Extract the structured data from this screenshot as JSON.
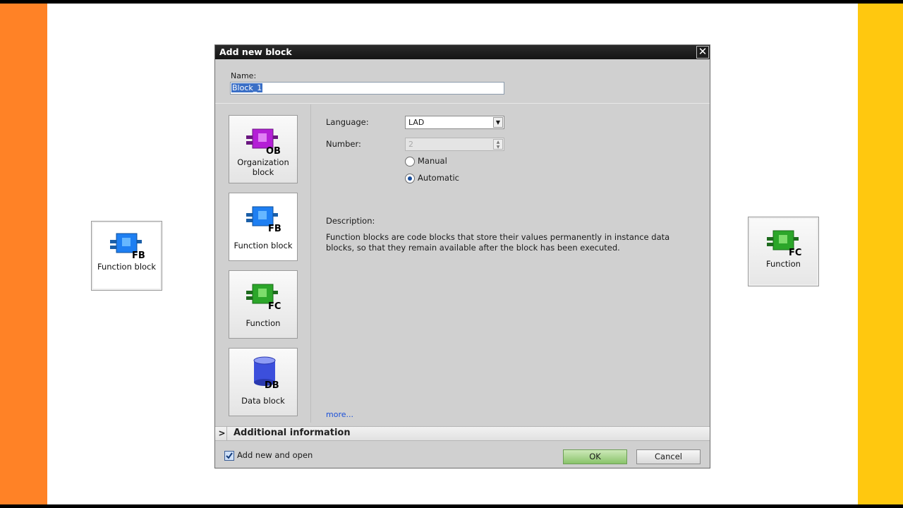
{
  "dialog": {
    "title": "Add new block",
    "name_label": "Name:",
    "name_value": "Block_1"
  },
  "block_types": [
    {
      "code": "OB",
      "label": "Organization block",
      "color": "#b41fd6",
      "selected": false
    },
    {
      "code": "FB",
      "label": "Function block",
      "color": "#1e7ff2",
      "selected": true
    },
    {
      "code": "FC",
      "label": "Function",
      "color": "#2ca62a",
      "selected": false
    },
    {
      "code": "DB",
      "label": "Data block",
      "color": "#3c4fdc",
      "selected": false
    }
  ],
  "properties": {
    "language_label": "Language:",
    "language_value": "LAD",
    "number_label": "Number:",
    "number_value": "2",
    "manual_label": "Manual",
    "automatic_label": "Automatic",
    "numbering_mode": "Automatic"
  },
  "description": {
    "heading": "Description:",
    "text": "Function blocks are code blocks that store their values permanently in instance data blocks, so that they remain available after the block has been executed.",
    "more_link": "more..."
  },
  "additional_info": {
    "label": "Additional information"
  },
  "footer": {
    "add_and_open_label": "Add new and open",
    "add_and_open_checked": true,
    "ok_label": "OK",
    "cancel_label": "Cancel"
  },
  "side_cards": {
    "left": {
      "code": "FB",
      "label": "Function block"
    },
    "right": {
      "code": "FC",
      "label": "Function"
    }
  },
  "colors": {
    "band_left": "#ff8226",
    "band_right": "#ffc80f",
    "ok_button": "#89c36a"
  }
}
